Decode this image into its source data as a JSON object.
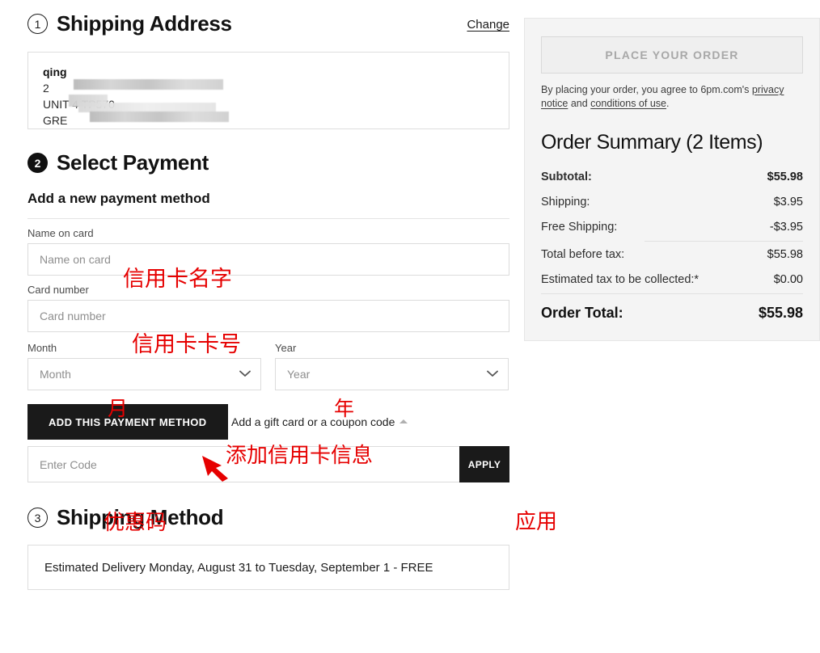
{
  "shipping_address": {
    "step_number": "1",
    "title": "Shipping Address",
    "change_label": "Change",
    "recipient_name": "qing",
    "line2_visible": "2",
    "line3_visible": "UNIT 4 TP570",
    "line4_visible": "GRE"
  },
  "payment": {
    "step_number": "2",
    "title": "Select Payment",
    "subtitle": "Add a new payment method",
    "name_label": "Name on card",
    "name_placeholder": "Name on card",
    "name_value": "",
    "number_label": "Card number",
    "number_placeholder": "Card number",
    "number_value": "",
    "month_label": "Month",
    "month_selected": "Month",
    "year_label": "Year",
    "year_selected": "Year",
    "add_button": "ADD THIS PAYMENT METHOD"
  },
  "gift_card": {
    "toggle_label": "Add a gift card or a coupon code",
    "code_placeholder": "Enter Code",
    "code_value": "",
    "apply_label": "APPLY"
  },
  "shipping_method": {
    "step_number": "3",
    "title": "Shipping Method",
    "option": "Estimated Delivery Monday, August 31 to Tuesday, September 1 - FREE"
  },
  "order_summary": {
    "place_order_label": "PLACE YOUR ORDER",
    "legal_prefix": "By placing your order, you agree to 6pm.com's ",
    "legal_link1": "privacy notice",
    "legal_mid": " and ",
    "legal_link2": "conditions of use",
    "legal_suffix": ".",
    "title": "Order Summary (2 Items)",
    "rows": [
      {
        "label": "Subtotal:",
        "value": "$55.98",
        "bold": true
      },
      {
        "label": "Shipping:",
        "value": "$3.95",
        "bold": false
      },
      {
        "label": "Free Shipping:",
        "value": "-$3.95",
        "bold": false
      },
      {
        "label": "Total before tax:",
        "value": "$55.98",
        "bold": false
      },
      {
        "label": "Estimated tax to be collected:*",
        "value": "$0.00",
        "bold": false
      }
    ],
    "total_label": "Order Total:",
    "total_value": "$55.98"
  },
  "annotations": {
    "color": "#e60000",
    "name_on_card": "信用卡名字",
    "card_number": "信用卡卡号",
    "month": "月",
    "year": "年",
    "add_payment": "添加信用卡信息",
    "coupon": "优惠码",
    "apply": "应用"
  }
}
